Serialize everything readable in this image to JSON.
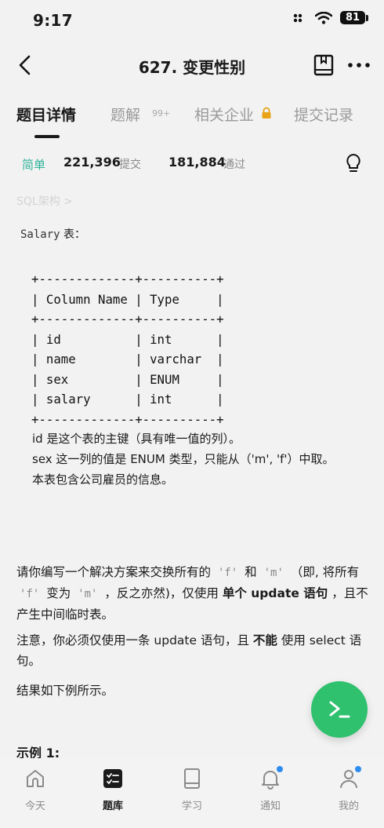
{
  "status_bar": {
    "time": "9:17",
    "battery": "81"
  },
  "nav": {
    "title": "627. 变更性别"
  },
  "tabs": {
    "detail": "题目详情",
    "solutions": "题解",
    "solutions_count": "99+",
    "companies": "相关企业",
    "submissions": "提交记录"
  },
  "stats": {
    "difficulty": "简单",
    "submits_num": "221,396",
    "submits_label": "提交",
    "accepted_num": "181,884",
    "accepted_label": "通过"
  },
  "tagline": "SQL架构 >",
  "schema": {
    "table_code": "Salary",
    "label_suffix": " 表：",
    "table_ascii": "+-------------+----------+\n| Column Name | Type     |\n+-------------+----------+\n| id          | int      |\n| name        | varchar  |\n| sex         | ENUM     |\n| salary      | int      |\n+-------------+----------+",
    "note_1": "id 是这个表的主键（具有唯一值的列）。",
    "note_2": "sex 这一列的值是 ENUM 类型，只能从（'m', 'f'）中取。",
    "note_3": "本表包含公司雇员的信息。"
  },
  "task": {
    "p1_a": "请你编写一个解决方案来交换所有的 ",
    "p1_code1": "'f'",
    "p1_b": " 和 ",
    "p1_code2": "'m'",
    "p1_c": " （即, 将所有 ",
    "p1_code3": "'f'",
    "p1_d": " 变为 ",
    "p1_code4": "'m'",
    "p1_e": " ，反之亦然)，仅使用 ",
    "p1_bold1": "单个 update 语句",
    "p1_f": " ，且不产生中间临时表。",
    "p2_a": "注意，你必须仅使用一条 update 语句，且 ",
    "p2_bold": "不能",
    "p2_b": " 使用 select 语句。",
    "p3": "结果如下例所示。"
  },
  "example_title": "示例 1:",
  "bottom_nav": {
    "today": "今天",
    "problems": "题库",
    "study": "学习",
    "notifications": "通知",
    "me": "我的"
  },
  "colors": {
    "accent_green": "#2fc16e",
    "easy": "#2fb399",
    "dot_blue": "#2d8cf0"
  }
}
